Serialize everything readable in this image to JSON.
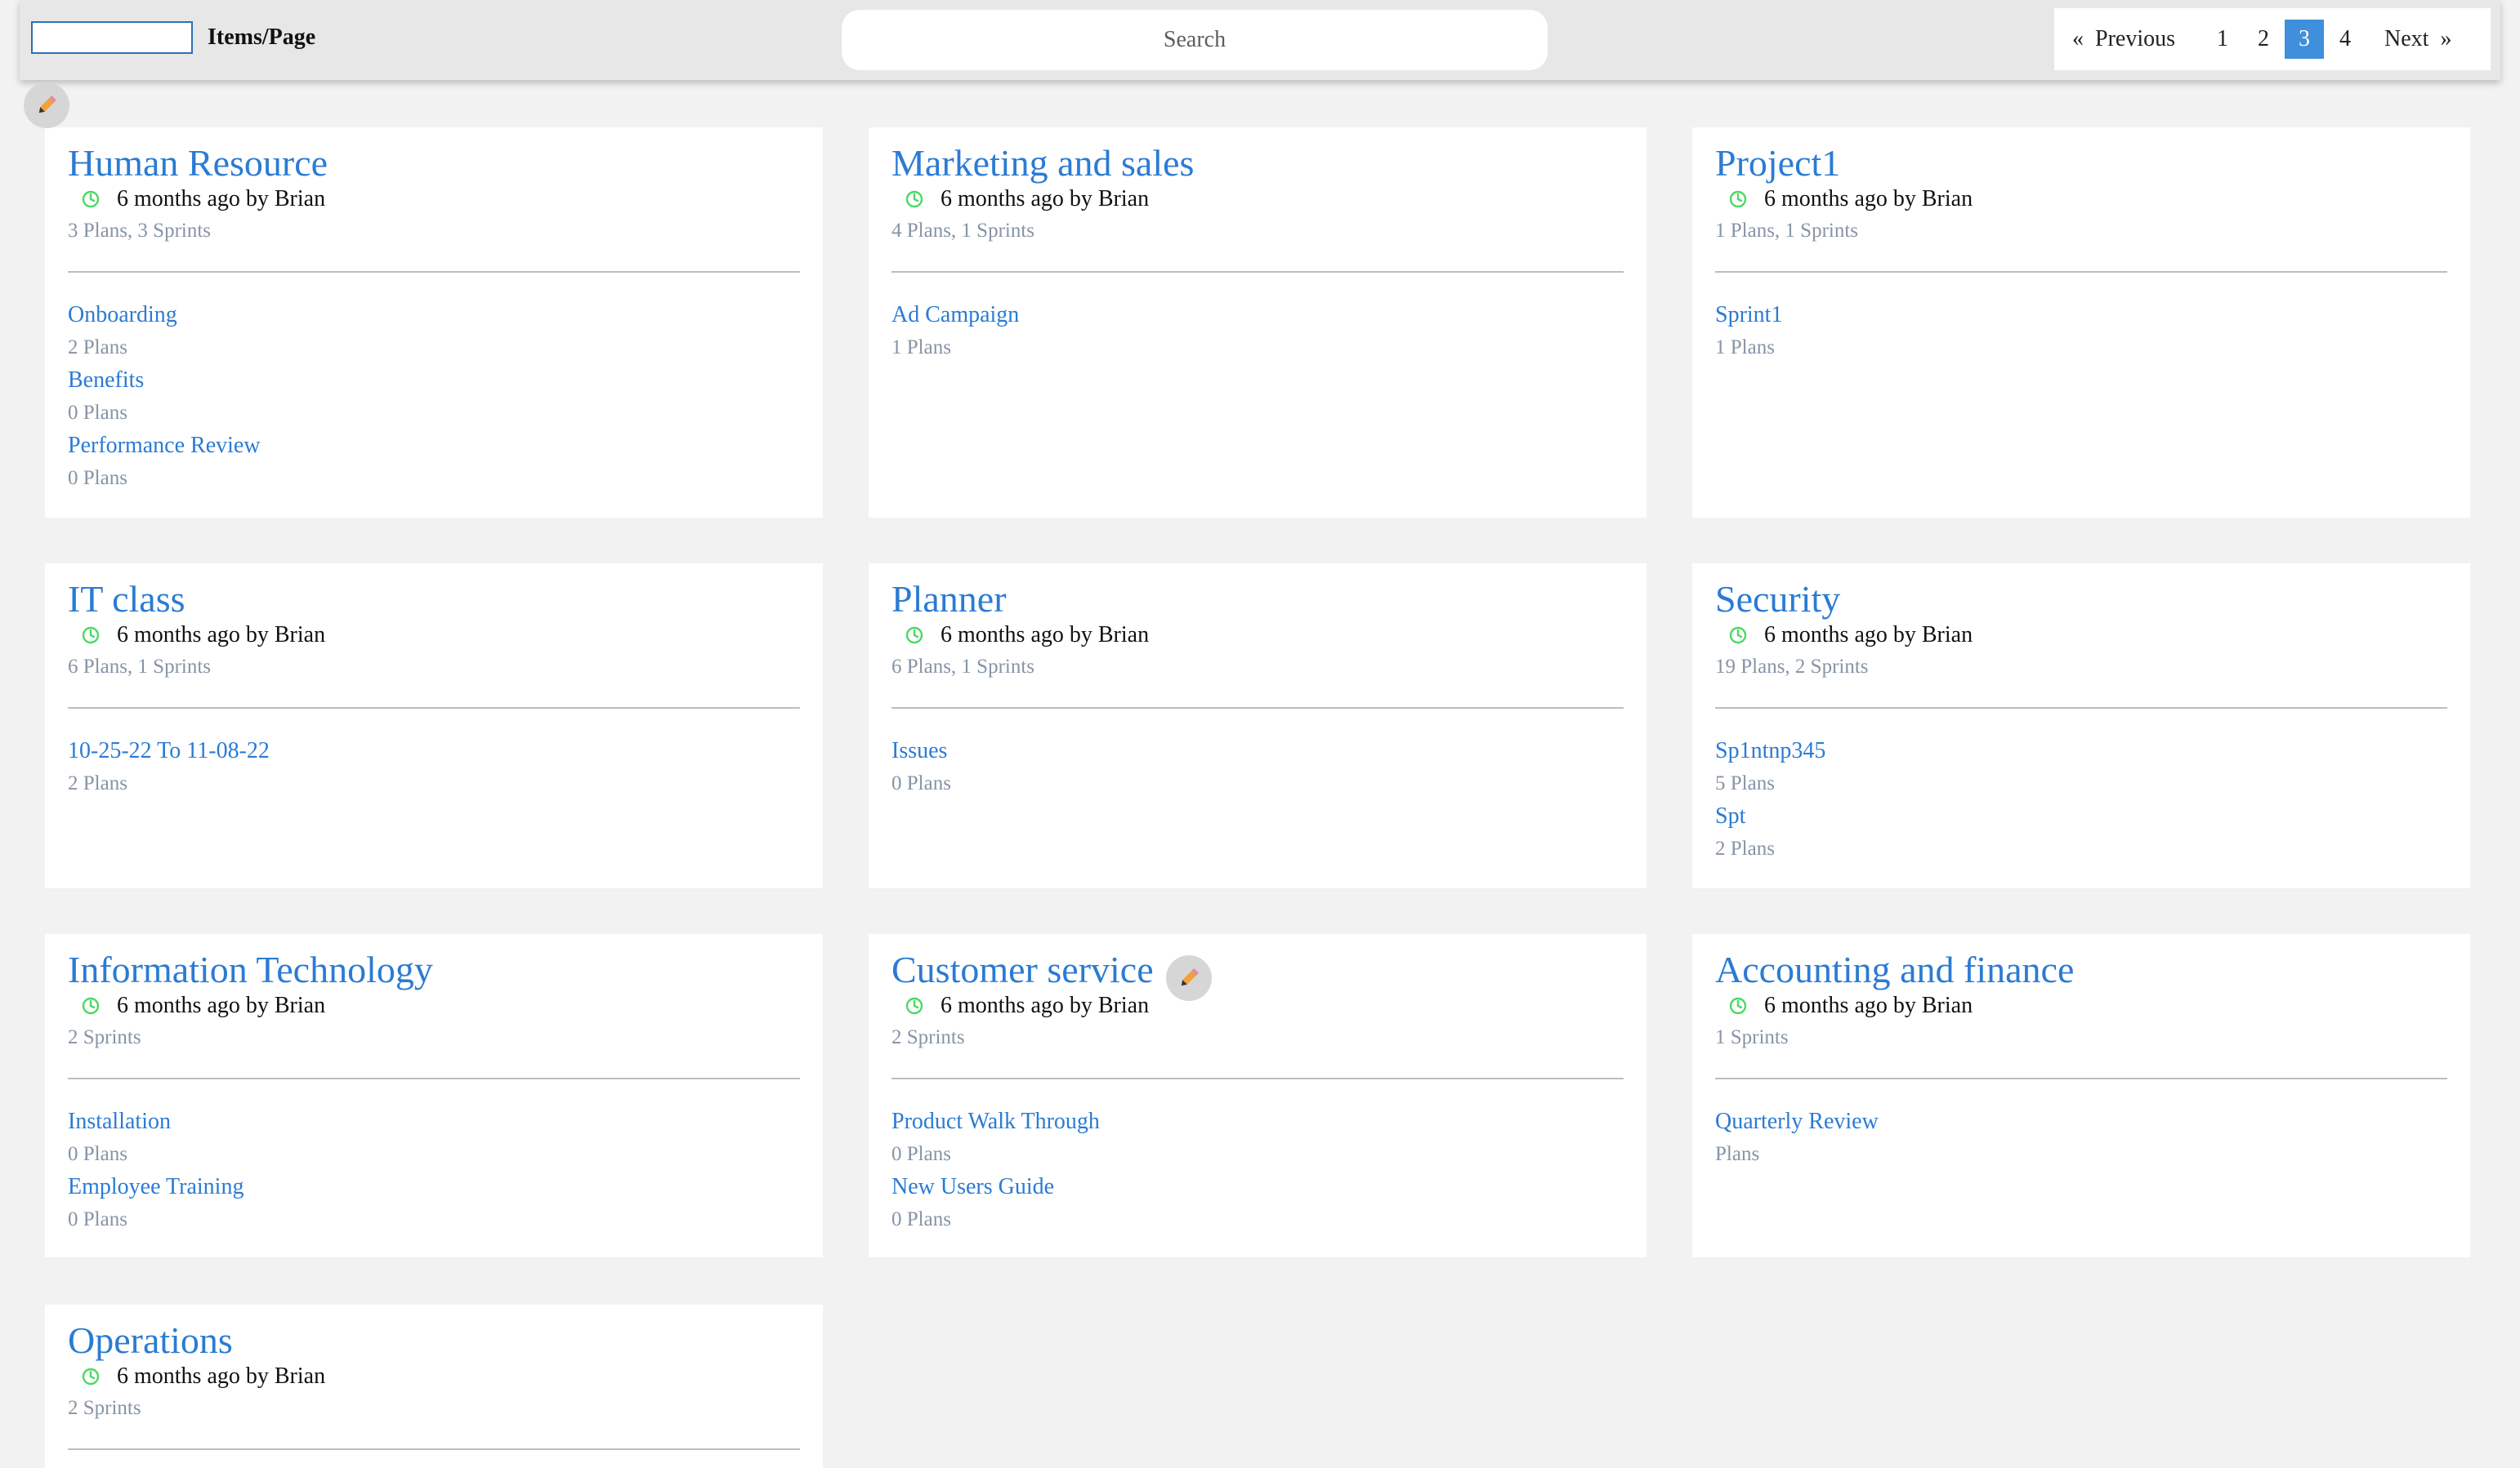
{
  "toolbar": {
    "items_per_page_value": "",
    "items_per_page_label": "Items/Page",
    "search_placeholder": "Search",
    "pagination": {
      "prev_arrow": "«",
      "prev_label": "Previous",
      "pages": [
        "1",
        "2",
        "3",
        "4"
      ],
      "active_page": "3",
      "next_label": "Next",
      "next_arrow": "»"
    }
  },
  "colors": {
    "accent": "#2b7bd3",
    "active_page": "#3f8fdc",
    "clock": "#4cd964",
    "muted": "#8694a6"
  },
  "icons": {
    "edit": "pencil-icon",
    "time": "clock-icon"
  },
  "cards": [
    {
      "title": "Human Resource",
      "meta": "6 months ago by Brian",
      "summary": "3 Plans, 3 Sprints",
      "items": [
        {
          "name": "Onboarding",
          "plans": "2 Plans"
        },
        {
          "name": "Benefits",
          "plans": "0 Plans"
        },
        {
          "name": "Performance Review",
          "plans": "0 Plans"
        }
      ]
    },
    {
      "title": "Marketing and sales",
      "meta": "6 months ago by Brian",
      "summary": "4 Plans, 1 Sprints",
      "items": [
        {
          "name": "Ad Campaign",
          "plans": "1 Plans"
        }
      ]
    },
    {
      "title": "Project1",
      "meta": "6 months ago by Brian",
      "summary": "1 Plans, 1 Sprints",
      "items": [
        {
          "name": "Sprint1",
          "plans": "1 Plans"
        }
      ]
    },
    {
      "title": "IT class",
      "meta": "6 months ago by Brian",
      "summary": "6 Plans, 1 Sprints",
      "items": [
        {
          "name": "10-25-22 To 11-08-22",
          "plans": "2 Plans"
        }
      ]
    },
    {
      "title": "Planner",
      "meta": "6 months ago by Brian",
      "summary": "6 Plans, 1 Sprints",
      "items": [
        {
          "name": "Issues",
          "plans": "0 Plans"
        }
      ]
    },
    {
      "title": "Security",
      "meta": "6 months ago by Brian",
      "summary": "19 Plans, 2 Sprints",
      "items": [
        {
          "name": "Sp1ntnp345",
          "plans": "5 Plans"
        },
        {
          "name": "Spt",
          "plans": "2 Plans"
        }
      ]
    },
    {
      "title": "Information Technology",
      "meta": "6 months ago by Brian",
      "summary": "2 Sprints",
      "items": [
        {
          "name": "Installation",
          "plans": "0 Plans"
        },
        {
          "name": "Employee Training",
          "plans": "0 Plans"
        }
      ]
    },
    {
      "title": "Customer service",
      "meta": "6 months ago by Brian",
      "summary": "2 Sprints",
      "items": [
        {
          "name": "Product Walk Through",
          "plans": "0 Plans"
        },
        {
          "name": "New Users Guide",
          "plans": "0 Plans"
        }
      ]
    },
    {
      "title": "Accounting and finance",
      "meta": "6 months ago by Brian",
      "summary": "1 Sprints",
      "items": [
        {
          "name": "Quarterly Review",
          "plans": "Plans"
        }
      ]
    },
    {
      "title": "Operations",
      "meta": "6 months ago by Brian",
      "summary": "2 Sprints",
      "items": []
    }
  ]
}
